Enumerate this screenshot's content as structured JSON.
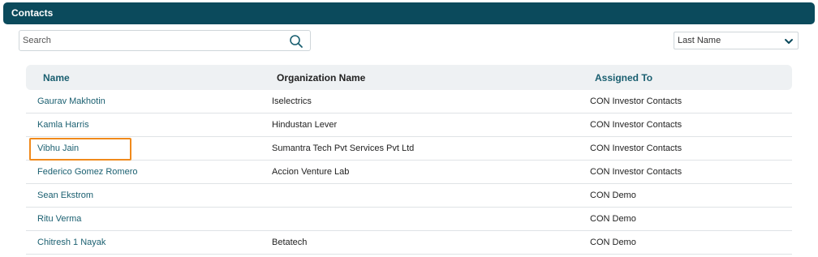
{
  "panel": {
    "title": "Contacts"
  },
  "search": {
    "placeholder": "Search",
    "value": ""
  },
  "sort": {
    "selected": "Last Name"
  },
  "table": {
    "headers": {
      "name": "Name",
      "org": "Organization Name",
      "assigned": "Assigned To"
    },
    "rows": [
      {
        "name": "Gaurav Makhotin",
        "org": "Iselectrics",
        "assigned": "CON Investor Contacts"
      },
      {
        "name": "Kamla Harris",
        "org": "Hindustan Lever",
        "assigned": "CON Investor Contacts"
      },
      {
        "name": "Vibhu Jain",
        "org": "Sumantra Tech Pvt Services Pvt Ltd",
        "assigned": "CON Investor Contacts"
      },
      {
        "name": "Federico Gomez Romero",
        "org": "Accion Venture Lab",
        "assigned": "CON Investor Contacts"
      },
      {
        "name": "Sean Ekstrom",
        "org": "",
        "assigned": "CON Demo"
      },
      {
        "name": "Ritu Verma",
        "org": "",
        "assigned": "CON Demo"
      },
      {
        "name": "Chitresh 1 Nayak",
        "org": "Betatech",
        "assigned": "CON Demo"
      }
    ]
  },
  "colors": {
    "header_bg": "#0b4a5c",
    "link": "#1a5f70",
    "highlight": "#f08a1c"
  },
  "icons": {
    "search": "search-icon",
    "dropdown": "chevron-down-icon"
  }
}
